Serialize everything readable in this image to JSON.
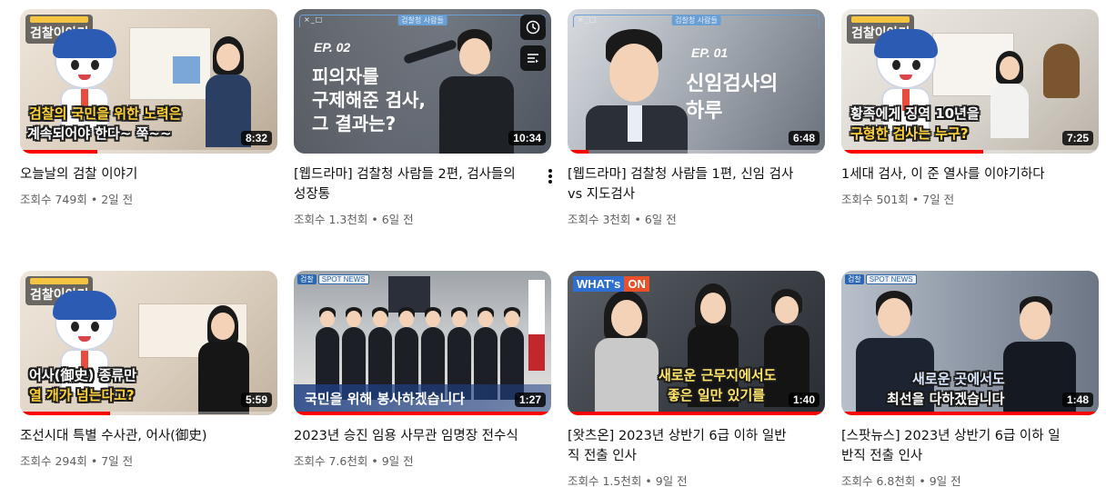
{
  "videos": [
    {
      "title": "오늘날의 검찰 이야기",
      "views": "조회수 749회",
      "age": "2일 전",
      "duration": "8:32",
      "thumb_caption_1": "검찰의 국민을 위한 노력은",
      "thumb_caption_2": "계속되어야 한다~ 쭉~~",
      "series": "검찰이야기",
      "progress": 0.3
    },
    {
      "title": "[웹드라마] 검찰청 사람들 2편, 검사들의 성장통",
      "views": "조회수 1.3천회",
      "age": "6일 전",
      "duration": "10:34",
      "thumb_episode": "EP. 02",
      "thumb_caption_1": "피의자를",
      "thumb_caption_2": "구제해준 검사,",
      "thumb_caption_3": "그 결과는?",
      "window_title": "검찰청 사람들"
    },
    {
      "title": "[웹드라마] 검찰청 사람들 1편, 신임 검사 vs 지도검사",
      "views": "조회수 3천회",
      "age": "6일 전",
      "duration": "6:48",
      "thumb_episode": "EP. 01",
      "thumb_caption_1": "신임검사의",
      "thumb_caption_2": "하루",
      "window_title": "검찰청 사람들",
      "progress": 0.08
    },
    {
      "title": "1세대 검사, 이 준 열사를 이야기하다",
      "views": "조회수 501회",
      "age": "7일 전",
      "duration": "7:25",
      "thumb_caption_1": "황족에게 징역 10년을",
      "thumb_caption_2": "구형한 검사는 누구?",
      "series": "검찰이야기",
      "progress": 0.55
    },
    {
      "title": "조선시대 특별 수사관, 어사(御史)",
      "views": "조회수 294회",
      "age": "7일 전",
      "duration": "5:59",
      "thumb_caption_1": "어사(御史) 종류만",
      "thumb_caption_2": "열 개가 넘는다고?",
      "series": "검찰이야기",
      "progress": 0.35
    },
    {
      "title": "2023년 승진 임용 사무관 임명장 전수식",
      "views": "조회수 7.6천회",
      "age": "9일 전",
      "duration": "1:27",
      "thumb_caption_1": "국민을 위해 봉사하겠습니다",
      "spot_label": "검찰",
      "spot_news": "SPOT NEWS",
      "progress": 1.0
    },
    {
      "title": "[왓츠온] 2023년 상반기 6급 이하 일반직 전출 인사",
      "views": "조회수 1.5천회",
      "age": "9일 전",
      "duration": "1:40",
      "thumb_caption_1": "새로운 근무지에서도",
      "thumb_caption_2": "좋은 일만 있기를",
      "whats_on": "WHAT's",
      "whats_on_2": "ON",
      "progress": 1.0
    },
    {
      "title": "[스팟뉴스] 2023년 상반기 6급 이하 일반직 전출 인사",
      "views": "조회수 6.8천회",
      "age": "9일 전",
      "duration": "1:48",
      "thumb_caption_1": "새로운 곳에서도",
      "thumb_caption_2": "최선을 다하겠습니다",
      "spot_label": "검찰",
      "spot_news": "SPOT NEWS",
      "progress": 1.0
    }
  ],
  "hover_actions": {
    "watch_later_icon": "clock-icon",
    "add_to_queue_icon": "queue-icon",
    "more_icon": "more-vertical-icon"
  },
  "colors": {
    "progress": "#ff0000",
    "caption_yellow": "#ffd23a",
    "meta_text": "#606060"
  }
}
